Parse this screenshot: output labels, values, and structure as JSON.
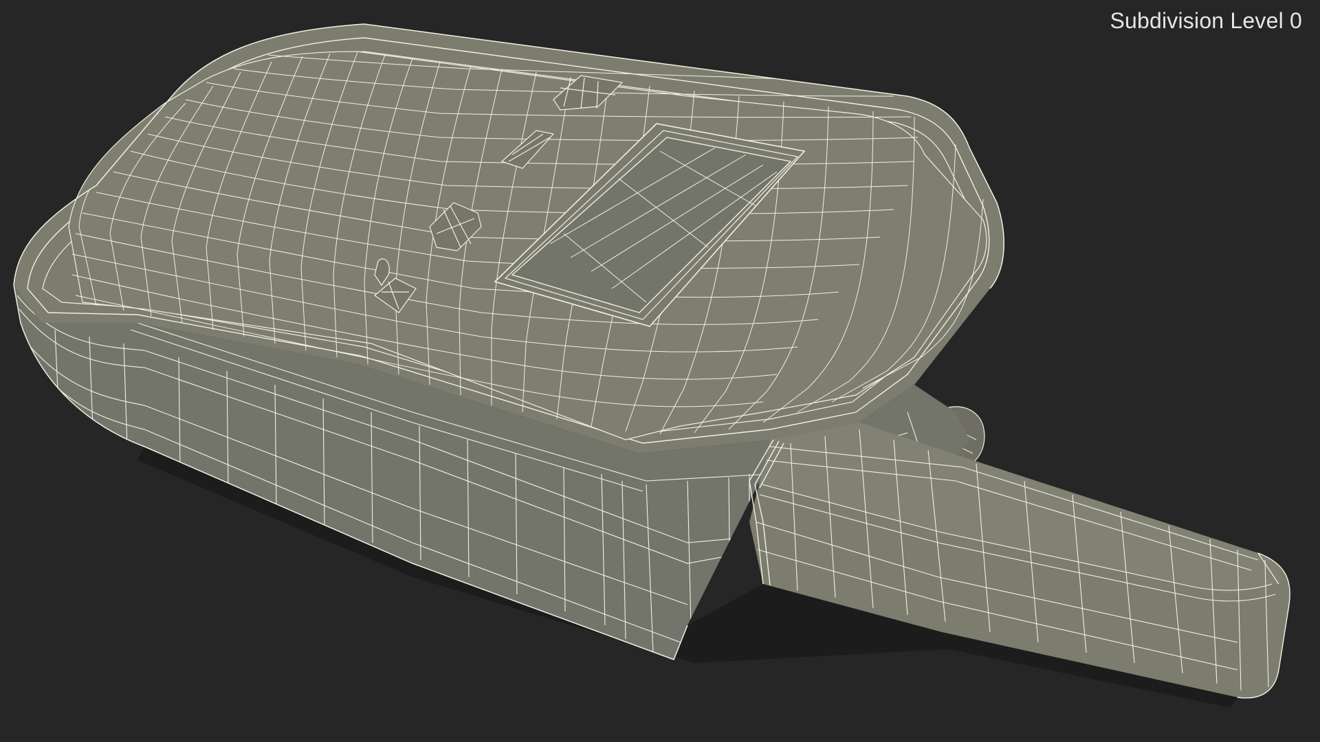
{
  "viewport": {
    "label": "Subdivision Level 0",
    "background_color": "#262626"
  },
  "model": {
    "surface_color": "#7c7d6e",
    "shadow_color": "#5e5f53",
    "highlight_color": "#8d8e7f",
    "wire_color": "#f2f1e4"
  }
}
